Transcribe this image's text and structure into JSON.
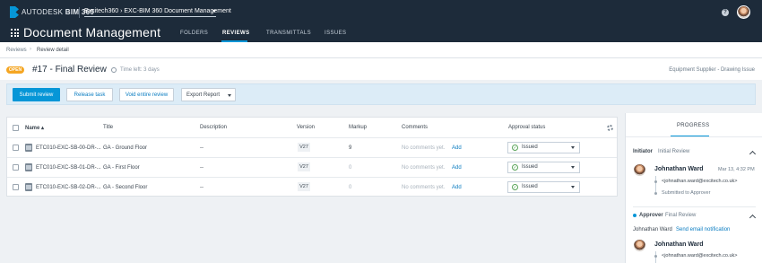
{
  "topbar": {
    "brand_a": "AUTODESK",
    "brand_b": "BIM 360",
    "project": "Excitech360 › EXC-BIM 360 Document Management"
  },
  "header": {
    "title": "Document Management",
    "tabs": [
      "FOLDERS",
      "REVIEWS",
      "TRANSMITTALS",
      "ISSUES"
    ],
    "active_tab": "REVIEWS"
  },
  "breadcrumb": {
    "parent": "Reviews",
    "current": "Review detail"
  },
  "review": {
    "status": "OPEN",
    "title": "#17 - Final Review",
    "time_left": "Time left: 3 days",
    "workflow": "Equipment Supplier - Drawing Issue"
  },
  "actions": {
    "submit": "Submit review",
    "release": "Release task",
    "void": "Void entire review",
    "export": "Export Report"
  },
  "table": {
    "headers": {
      "name": "Name",
      "title": "Title",
      "description": "Description",
      "version": "Version",
      "markup": "Markup",
      "comments": "Comments",
      "approval": "Approval status"
    },
    "rows": [
      {
        "name": "ETC010-EXC-SB-00-DR-...",
        "title": "GA - Ground Floor",
        "description": "--",
        "version": "V27",
        "markup": "9",
        "comments": "No comments yet.",
        "add": "Add",
        "status": "Issued"
      },
      {
        "name": "ETC010-EXC-SB-01-DR-...",
        "title": "GA - First Floor",
        "description": "--",
        "version": "V27",
        "markup": "0",
        "comments": "No comments yet.",
        "add": "Add",
        "status": "Issued"
      },
      {
        "name": "ETC010-EXC-SB-02-DR-...",
        "title": "GA - Second Floor",
        "description": "--",
        "version": "V27",
        "markup": "0",
        "comments": "No comments yet.",
        "add": "Add",
        "status": "Issued"
      }
    ]
  },
  "progress": {
    "tab": "PROGRESS",
    "initiator": {
      "role": "Initiator",
      "step": "Initial Review",
      "name": "Johnathan Ward",
      "date": "Mar 13, 4:32 PM",
      "email": "<johnathan.ward@excitech.co.uk>",
      "action": "Submitted to Approver"
    },
    "approver": {
      "role": "Approver",
      "step": "Final Review",
      "assignee": "Johnathan Ward",
      "notify": "Send email notification",
      "name": "Johnathan Ward",
      "email": "<johnathan.ward@excitech.co.uk>"
    }
  }
}
